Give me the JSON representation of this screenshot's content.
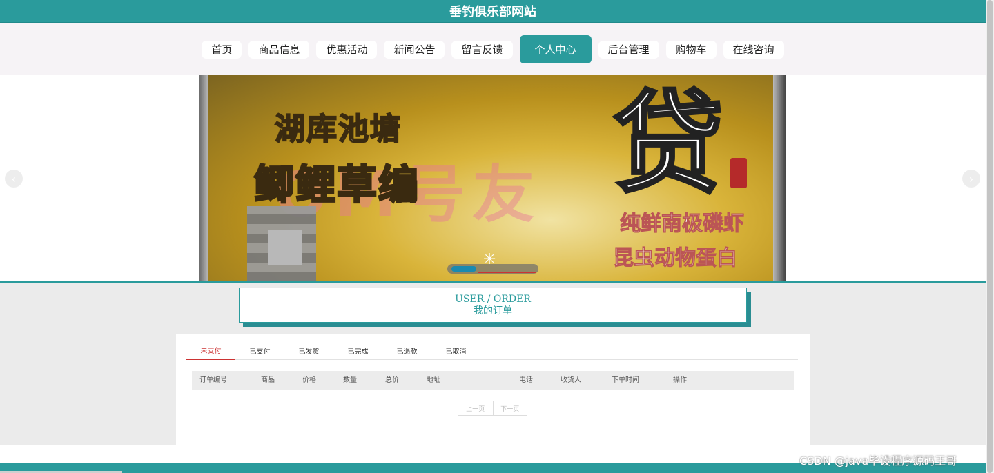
{
  "header": {
    "site_title": "垂钓俱乐部网站"
  },
  "nav": {
    "items": [
      {
        "label": "首页",
        "active": false
      },
      {
        "label": "商品信息",
        "active": false
      },
      {
        "label": "优惠活动",
        "active": false
      },
      {
        "label": "新闻公告",
        "active": false
      },
      {
        "label": "留言反馈",
        "active": false
      },
      {
        "label": "个人中心",
        "active": true
      },
      {
        "label": "后台管理",
        "active": false
      },
      {
        "label": "购物车",
        "active": false
      },
      {
        "label": "在线咨询",
        "active": false
      }
    ]
  },
  "banner": {
    "text_line1": "湖库池塘",
    "text_line2": "鲫鲤草编",
    "big_char": "贷",
    "watermark": "OM号友",
    "right_line1": "纯鲜南极磷虾",
    "right_line2": "昆虫动物蛋白",
    "prev_icon": "chevron-left-icon",
    "next_icon": "chevron-right-icon",
    "spinner": "✳"
  },
  "section": {
    "title_en": "USER / ORDER",
    "title_cn": "我的订单"
  },
  "order_tabs": [
    {
      "label": "未支付",
      "active": true
    },
    {
      "label": "已支付",
      "active": false
    },
    {
      "label": "已发货",
      "active": false
    },
    {
      "label": "已完成",
      "active": false
    },
    {
      "label": "已退款",
      "active": false
    },
    {
      "label": "已取消",
      "active": false
    }
  ],
  "table": {
    "headers": [
      "订单编号",
      "商品",
      "价格",
      "数量",
      "总价",
      "地址",
      "电话",
      "收货人",
      "下单时间",
      "操作"
    ]
  },
  "pager": {
    "prev": "上一页",
    "next": "下一页"
  },
  "credit": "CSDN @java毕设程序源码王哥",
  "colors": {
    "primary": "#2a9b9c",
    "active_tab": "#cc3333"
  }
}
